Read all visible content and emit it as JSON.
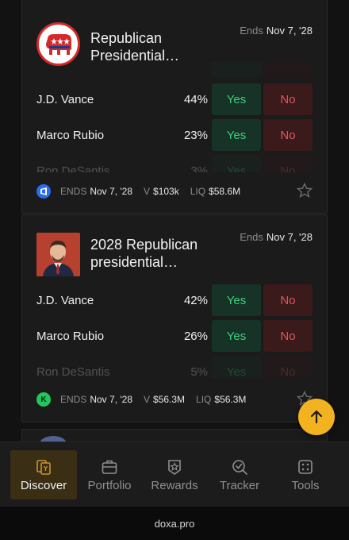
{
  "markets": [
    {
      "title": "Republican Presidential…",
      "ends_label": "Ends",
      "ends_date": "Nov 7, '28",
      "logo": "gop-elephant-icon",
      "outcomes": [
        {
          "name": "J.D. Vance",
          "pct": "44%",
          "yes": "Yes",
          "no": "No"
        },
        {
          "name": "Marco Rubio",
          "pct": "23%",
          "yes": "Yes",
          "no": "No"
        },
        {
          "name": "Ron DeSantis",
          "pct": "3%",
          "yes": "Yes",
          "no": "No"
        }
      ],
      "footer": {
        "ends_label": "ENDS",
        "ends_date": "Nov 7, '28",
        "v_label": "V",
        "volume": "$103k",
        "liq_label": "LIQ",
        "liquidity": "$58.6M"
      },
      "source_icon": "polymarket-icon"
    },
    {
      "title": "2028 Republican presidential…",
      "ends_label": "Ends",
      "ends_date": "Nov 7, '28",
      "logo": "jd-vance-photo",
      "outcomes": [
        {
          "name": "J.D. Vance",
          "pct": "42%",
          "yes": "Yes",
          "no": "No"
        },
        {
          "name": "Marco Rubio",
          "pct": "26%",
          "yes": "Yes",
          "no": "No"
        },
        {
          "name": "Ron DeSantis",
          "pct": "5%",
          "yes": "Yes",
          "no": "No"
        }
      ],
      "footer": {
        "ends_label": "ENDS",
        "ends_date": "Nov 7, '28",
        "v_label": "V",
        "volume": "$56.3M",
        "liq_label": "LIQ",
        "liquidity": "$56.3M"
      },
      "source_icon": "kalshi-icon",
      "source_letter": "K"
    }
  ],
  "tabs": [
    {
      "label": "Discover",
      "icon": "discover-cards-icon",
      "active": true
    },
    {
      "label": "Portfolio",
      "icon": "briefcase-icon",
      "active": false
    },
    {
      "label": "Rewards",
      "icon": "badge-star-icon",
      "active": false
    },
    {
      "label": "Tracker",
      "icon": "magnifier-check-icon",
      "active": false
    },
    {
      "label": "Tools",
      "icon": "dice-icon",
      "active": false
    }
  ],
  "url": "doxa.pro",
  "colors": {
    "yes": "#3fcf7a",
    "no": "#e05656",
    "accent": "#f3b321"
  }
}
